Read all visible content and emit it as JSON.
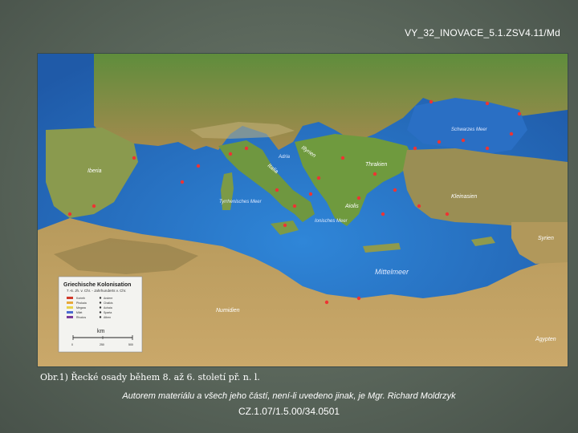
{
  "header": {
    "code": "VY_32_INOVACE_5.1.ZSV4.11/Md"
  },
  "map": {
    "regions": {
      "iberia": "Iberia",
      "thrakien": "Thrakien",
      "kleinasien": "Kleinasien",
      "aiolis": "Aiolis",
      "syrien": "Syrien",
      "aegypten": "Ägypten",
      "numidien": "Numidien",
      "illyria": "Illyrien",
      "italia": "Italia"
    },
    "seas": {
      "schwarzes_meer": "Schwarzes Meer",
      "mittelmeer": "Mittelmeer",
      "tyrrhenisches_meer": "Tyrrhenisches Meer",
      "ionisches_meer": "Ionisches Meer",
      "adria": "Adria"
    },
    "legend": {
      "title": "Griechische Kolonisation",
      "subtitle": "7.-6. Jh. v. Chr. - Jahrhunderts v. Chr.",
      "items": [
        "Korinth",
        "Phokaia",
        "Megara",
        "Milet",
        "Rhodos",
        "Andere",
        "Chalkis",
        "Achaia",
        "Sparta",
        "Athen"
      ],
      "km_label": "km",
      "scale_ticks": [
        "0",
        "250",
        "500"
      ]
    }
  },
  "caption": "Obr.1) Řecké osady během 8. až 6. století př. n. l.",
  "credit": "Autorem materiálu a všech jeho částí, není-li uvedeno jinak, je Mgr. Richard Moldrzyk",
  "project": "CZ.1.07/1.5.00/34.0501"
}
